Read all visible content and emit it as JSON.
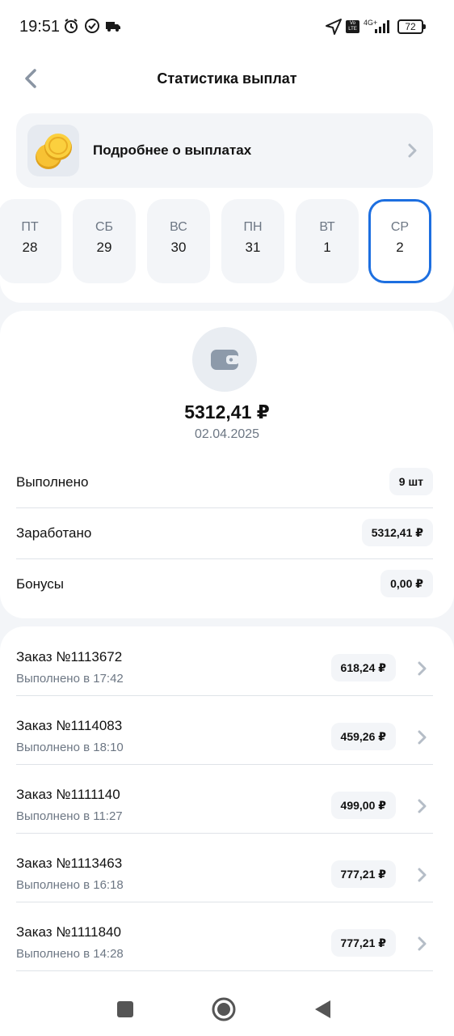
{
  "status_bar": {
    "time": "19:51",
    "network": "4G+",
    "volte": "Vo LTE",
    "battery": "72"
  },
  "header": {
    "title": "Статистика выплат",
    "back_icon": "chevron-left-icon"
  },
  "info_card": {
    "label": "Подробнее о выплатах",
    "icon": "coin-icon"
  },
  "days": [
    {
      "name": "ПТ",
      "num": "28",
      "selected": false
    },
    {
      "name": "СБ",
      "num": "29",
      "selected": false
    },
    {
      "name": "ВС",
      "num": "30",
      "selected": false
    },
    {
      "name": "ПН",
      "num": "31",
      "selected": false
    },
    {
      "name": "ВТ",
      "num": "1",
      "selected": false
    },
    {
      "name": "СР",
      "num": "2",
      "selected": true
    }
  ],
  "summary": {
    "amount": "5312,41 ₽",
    "date": "02.04.2025",
    "rows": [
      {
        "label": "Выполнено",
        "value": "9 шт"
      },
      {
        "label": "Заработано",
        "value": "5312,41 ₽"
      },
      {
        "label": "Бонусы",
        "value": "0,00 ₽"
      }
    ]
  },
  "orders": [
    {
      "title": "Заказ №1113672",
      "subtitle": "Выполнено в 17:42",
      "amount": "618,24 ₽"
    },
    {
      "title": "Заказ №1114083",
      "subtitle": "Выполнено в 18:10",
      "amount": "459,26 ₽"
    },
    {
      "title": "Заказ №1111140",
      "subtitle": "Выполнено в 11:27",
      "amount": "499,00 ₽"
    },
    {
      "title": "Заказ №1113463",
      "subtitle": "Выполнено в 16:18",
      "amount": "777,21 ₽"
    },
    {
      "title": "Заказ №1111840",
      "subtitle": "Выполнено в 14:28",
      "amount": "777,21 ₽"
    }
  ],
  "colors": {
    "accent": "#1d6fe0",
    "background": "#f3f5f8",
    "muted_text": "#6d7784"
  }
}
